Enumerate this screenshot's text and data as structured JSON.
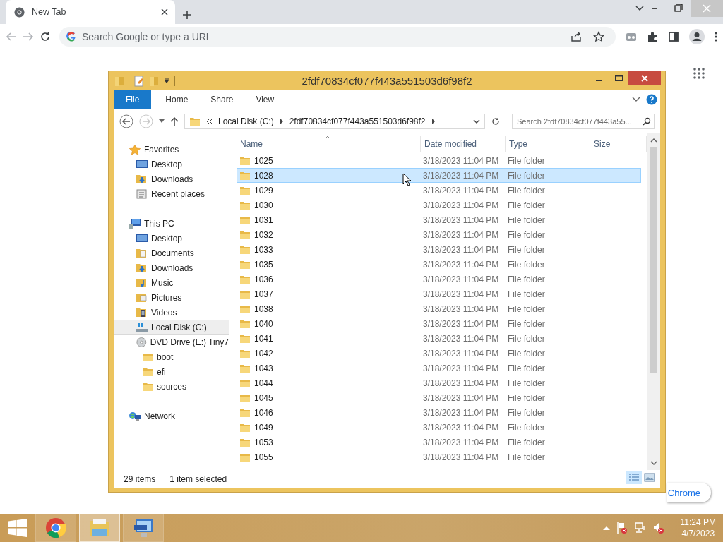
{
  "browser": {
    "tab": {
      "title": "New Tab"
    },
    "address": {
      "placeholder": "Search Google or type a URL"
    }
  },
  "page": {
    "customize_button": "Chrome"
  },
  "explorer": {
    "title": "2fdf70834cf077f443a551503d6f98f2",
    "ribbon_tabs": [
      {
        "label": "File",
        "kind": "file",
        "selected": false
      },
      {
        "label": "Home",
        "kind": "tab",
        "selected": false
      },
      {
        "label": "Share",
        "kind": "tab",
        "selected": false
      },
      {
        "label": "View",
        "kind": "tab",
        "selected": false
      }
    ],
    "path": [
      "Local Disk (C:)",
      "2fdf70834cf077f443a551503d6f98f2"
    ],
    "search": {
      "placeholder": "Search 2fdf70834cf077f443a55..."
    },
    "sidebar": [
      {
        "label": "Favorites",
        "kind": "star",
        "selected": false,
        "children": [
          {
            "label": "Desktop",
            "kind": "desktop",
            "selected": false
          },
          {
            "label": "Downloads",
            "kind": "download",
            "selected": false
          },
          {
            "label": "Recent places",
            "kind": "recent",
            "selected": false
          }
        ]
      },
      {
        "label": "This PC",
        "kind": "pc",
        "selected": false,
        "children": [
          {
            "label": "Desktop",
            "kind": "desktop",
            "selected": false
          },
          {
            "label": "Documents",
            "kind": "documents",
            "selected": false
          },
          {
            "label": "Downloads",
            "kind": "download",
            "selected": false
          },
          {
            "label": "Music",
            "kind": "music",
            "selected": false
          },
          {
            "label": "Pictures",
            "kind": "pictures",
            "selected": false
          },
          {
            "label": "Videos",
            "kind": "videos",
            "selected": false
          },
          {
            "label": "Local Disk (C:)",
            "kind": "disk",
            "selected": true
          },
          {
            "label": "DVD Drive (E:) Tiny7",
            "kind": "dvd",
            "selected": false,
            "children": [
              {
                "label": "boot",
                "kind": "folder",
                "selected": false
              },
              {
                "label": "efi",
                "kind": "folder",
                "selected": false
              },
              {
                "label": "sources",
                "kind": "folder",
                "selected": false
              }
            ]
          }
        ]
      },
      {
        "label": "Network",
        "kind": "network",
        "selected": false
      }
    ],
    "columns": [
      "Name",
      "Date modified",
      "Type",
      "Size"
    ],
    "rows": [
      {
        "name": "1025",
        "date": "3/18/2023 11:04 PM",
        "type": "File folder",
        "selected": false
      },
      {
        "name": "1028",
        "date": "3/18/2023 11:04 PM",
        "type": "File folder",
        "selected": true
      },
      {
        "name": "1029",
        "date": "3/18/2023 11:04 PM",
        "type": "File folder",
        "selected": false
      },
      {
        "name": "1030",
        "date": "3/18/2023 11:04 PM",
        "type": "File folder",
        "selected": false
      },
      {
        "name": "1031",
        "date": "3/18/2023 11:04 PM",
        "type": "File folder",
        "selected": false
      },
      {
        "name": "1032",
        "date": "3/18/2023 11:04 PM",
        "type": "File folder",
        "selected": false
      },
      {
        "name": "1033",
        "date": "3/18/2023 11:04 PM",
        "type": "File folder",
        "selected": false
      },
      {
        "name": "1035",
        "date": "3/18/2023 11:04 PM",
        "type": "File folder",
        "selected": false
      },
      {
        "name": "1036",
        "date": "3/18/2023 11:04 PM",
        "type": "File folder",
        "selected": false
      },
      {
        "name": "1037",
        "date": "3/18/2023 11:04 PM",
        "type": "File folder",
        "selected": false
      },
      {
        "name": "1038",
        "date": "3/18/2023 11:04 PM",
        "type": "File folder",
        "selected": false
      },
      {
        "name": "1040",
        "date": "3/18/2023 11:04 PM",
        "type": "File folder",
        "selected": false
      },
      {
        "name": "1041",
        "date": "3/18/2023 11:04 PM",
        "type": "File folder",
        "selected": false
      },
      {
        "name": "1042",
        "date": "3/18/2023 11:04 PM",
        "type": "File folder",
        "selected": false
      },
      {
        "name": "1043",
        "date": "3/18/2023 11:04 PM",
        "type": "File folder",
        "selected": false
      },
      {
        "name": "1044",
        "date": "3/18/2023 11:04 PM",
        "type": "File folder",
        "selected": false
      },
      {
        "name": "1045",
        "date": "3/18/2023 11:04 PM",
        "type": "File folder",
        "selected": false
      },
      {
        "name": "1046",
        "date": "3/18/2023 11:04 PM",
        "type": "File folder",
        "selected": false
      },
      {
        "name": "1049",
        "date": "3/18/2023 11:04 PM",
        "type": "File folder",
        "selected": false
      },
      {
        "name": "1053",
        "date": "3/18/2023 11:04 PM",
        "type": "File folder",
        "selected": false
      },
      {
        "name": "1055",
        "date": "3/18/2023 11:04 PM",
        "type": "File folder",
        "selected": false
      }
    ],
    "status": {
      "count": "29 items",
      "selection": "1 item selected"
    }
  },
  "taskbar": {
    "apps": [
      {
        "kind": "chrome",
        "active": false
      },
      {
        "kind": "explorer",
        "active": true
      },
      {
        "kind": "remote",
        "active": false
      }
    ],
    "clock": {
      "time": "11:24 PM",
      "date": "4/7/2023"
    }
  }
}
